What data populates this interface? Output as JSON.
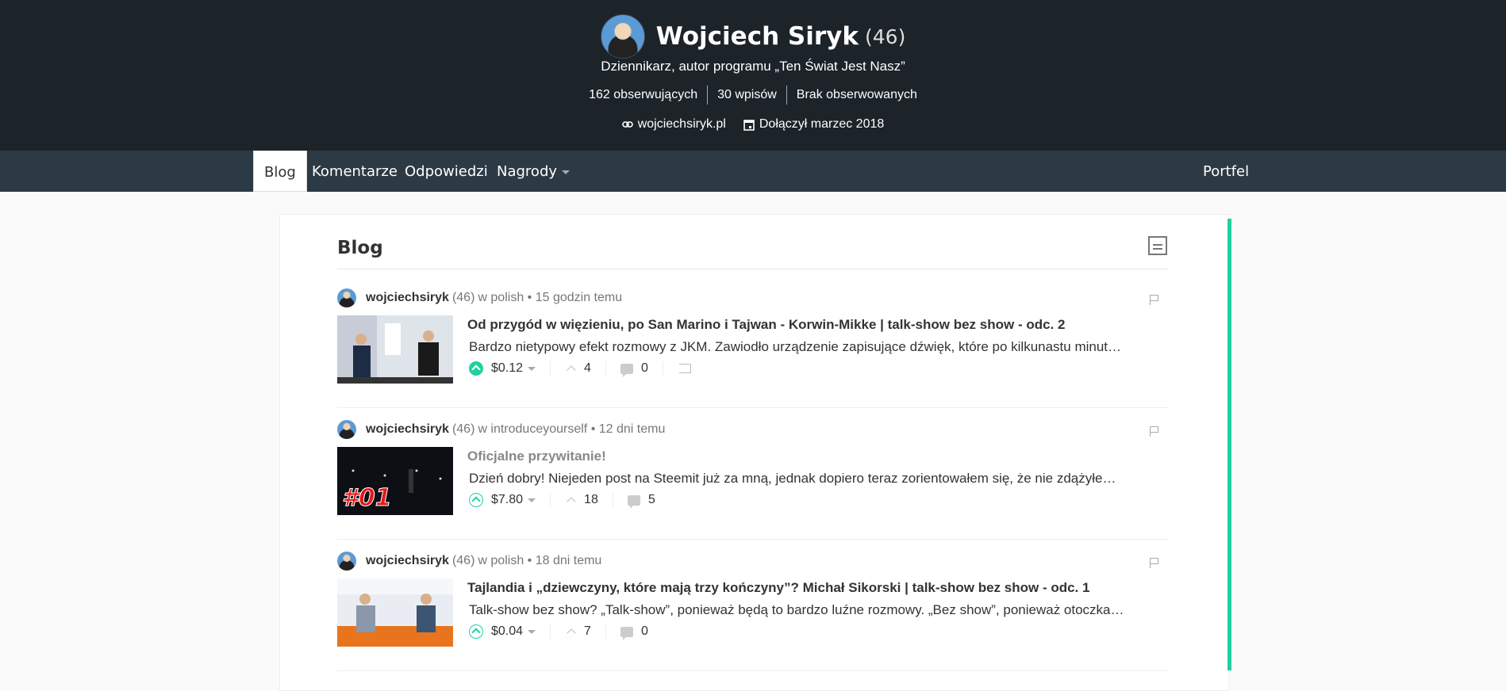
{
  "header": {
    "name": "Wojciech Siryk",
    "reputation": "(46)",
    "bio": "Dziennikarz, autor programu „Ten Świat Jest Nasz”",
    "stats": [
      "162 obserwujących",
      "30 wpisów",
      "Brak obserwowanych"
    ],
    "website": "wojciechsiryk.pl",
    "joined": "Dołączył marzec 2018"
  },
  "nav": {
    "tabs": [
      "Blog",
      "Komentarze",
      "Odpowiedzi",
      "Nagrody"
    ],
    "wallet": "Portfel"
  },
  "blog": {
    "heading": "Blog"
  },
  "posts": [
    {
      "author": "wojciechsiryk",
      "rep": "(46)",
      "category": "w polish",
      "time": "• 15 godzin temu",
      "title": "Od przygód w więzieniu, po San Marino i Tajwan - Korwin-Mikke | talk-show bez show - odc. 2",
      "body": "Bardzo nietypowy efekt rozmowy z JKM. Zawiodło urządzenie zapisujące dźwięk, które po kilkunastu minut…",
      "payout": "$0.12",
      "votes": "4",
      "comments": "0"
    },
    {
      "author": "wojciechsiryk",
      "rep": "(46)",
      "category": "w introduceyourself",
      "time": "• 12 dni temu",
      "title": "Oficjalne przywitanie!",
      "body": "Dzień dobry! Niejeden post na Steemit już za mną, jednak dopiero teraz zorientowałem się, że nie zdążyłe…",
      "payout": "$7.80",
      "votes": "18",
      "comments": "5",
      "thumb_text": "#01"
    },
    {
      "author": "wojciechsiryk",
      "rep": "(46)",
      "category": "w polish",
      "time": "• 18 dni temu",
      "title": "Tajlandia i „dziewczyny, które mają trzy kończyny”? Michał Sikorski | talk-show bez show - odc. 1",
      "body": "Talk-show bez show? „Talk-show”, ponieważ będą to bardzo luźne rozmowy. „Bez show”, ponieważ otoczka…",
      "payout": "$0.04",
      "votes": "7",
      "comments": "0"
    }
  ],
  "colors": {
    "header_bg": "#1c2329",
    "nav_bg": "#2c3a45",
    "accent": "#1fd1a1"
  }
}
